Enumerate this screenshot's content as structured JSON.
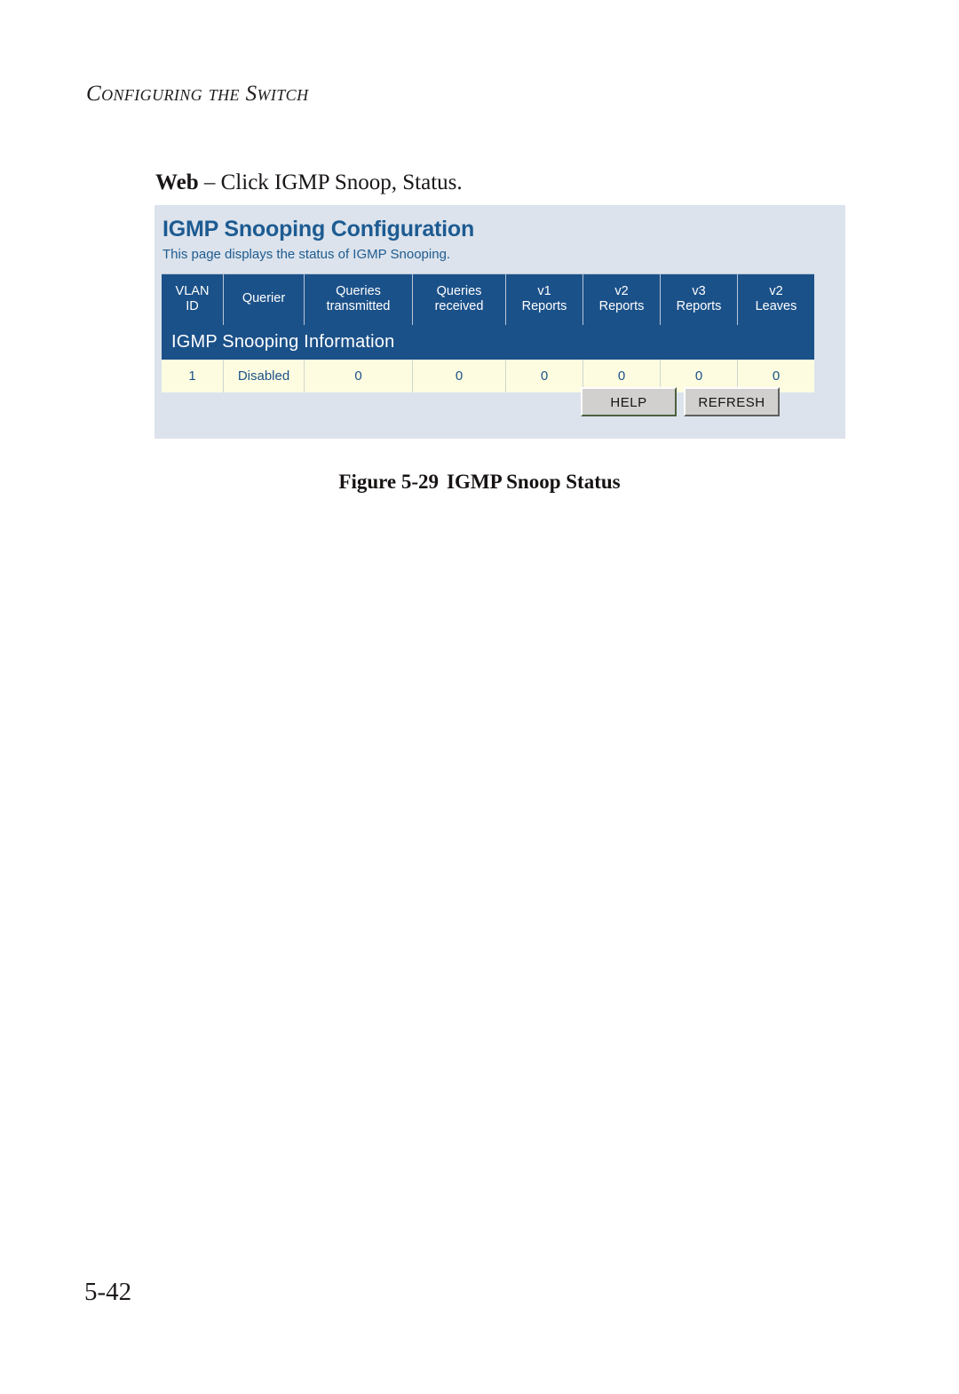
{
  "document": {
    "running_header": "Configuring the Switch",
    "page_number": "5-42",
    "intro": {
      "lead": "Web",
      "rest": " – Click IGMP Snoop, Status."
    },
    "figure_caption": {
      "number": "Figure 5-29",
      "title": "IGMP Snoop Status"
    }
  },
  "web_panel": {
    "title": "IGMP Snooping Configuration",
    "subtitle": "This page displays the status of IGMP Snooping.",
    "section_title": "IGMP Snooping Information",
    "table": {
      "columns": [
        "VLAN\nID",
        "Querier",
        "Queries\ntransmitted",
        "Queries\nreceived",
        "v1\nReports",
        "v2\nReports",
        "v3\nReports",
        "v2\nLeaves"
      ],
      "columns_line1": [
        "VLAN",
        "Querier",
        "Queries",
        "Queries",
        "v1",
        "v2",
        "v3",
        "v2"
      ],
      "columns_line2": [
        "ID",
        "",
        "transmitted",
        "received",
        "Reports",
        "Reports",
        "Reports",
        "Leaves"
      ],
      "rows": [
        {
          "vlan_id": "1",
          "querier": "Disabled",
          "queries_transmitted": "0",
          "queries_received": "0",
          "v1_reports": "0",
          "v2_reports": "0",
          "v3_reports": "0",
          "v2_leaves": "0"
        }
      ]
    },
    "buttons": {
      "help": "HELP",
      "refresh": "REFRESH"
    },
    "colors": {
      "panel_background": "#dce3ec",
      "header_blue": "#1b5189",
      "title_blue": "#1d5b92",
      "row_cream": "#fdfce0",
      "cell_text_blue": "#1c5189",
      "button_face": "#d1d0ce"
    }
  }
}
